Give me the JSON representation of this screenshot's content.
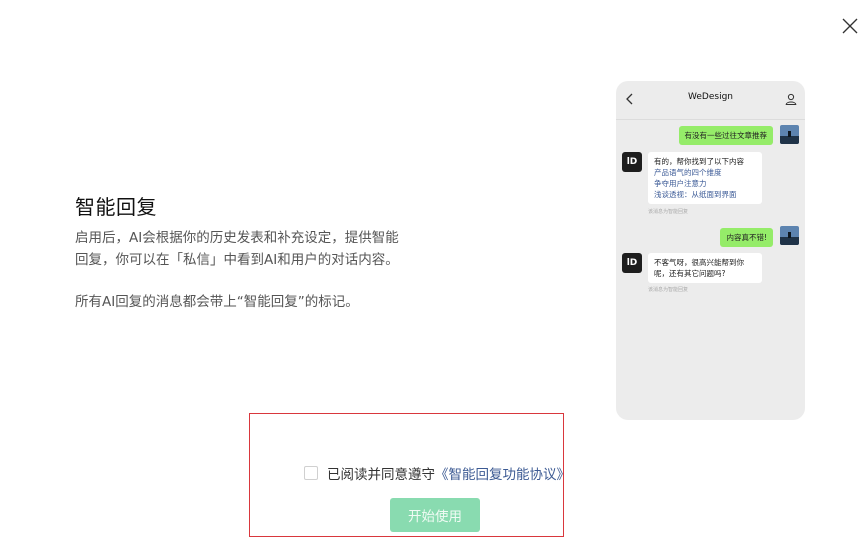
{
  "title": "智能回复",
  "description": {
    "para1": "启用后，AI会根据你的历史发表和补充设定，提供智能回复，你可以在「私信」中看到AI和用户的对话内容。",
    "para2": "所有AI回复的消息都会带上“智能回复”的标记。"
  },
  "phone": {
    "header_title": "WeDesign",
    "messages": {
      "user_msg1": "有没有一些过往文章推荐",
      "bot_reply1_intro": "有的，帮你找到了以下内容",
      "bot_reply1_links": [
        "产品语气的四个维度",
        "争夺用户注意力",
        "浅谈透视：从纸面到界面"
      ],
      "bot_note": "该消息为智能回复",
      "user_msg2": "内容真不错!",
      "bot_reply2": "不客气呀，很高兴能帮到你呢，还有其它问题吗?",
      "bot_avatar_label": "lD"
    }
  },
  "agreement": {
    "text": "已阅读并同意遵守",
    "link": "《智能回复功能协议》",
    "checked": false
  },
  "start_button": "开始使用",
  "colors": {
    "primary_button": "#89dbb0",
    "link": "#3c5a93",
    "user_bubble": "#95ec69",
    "highlight_border": "#d9373d"
  }
}
